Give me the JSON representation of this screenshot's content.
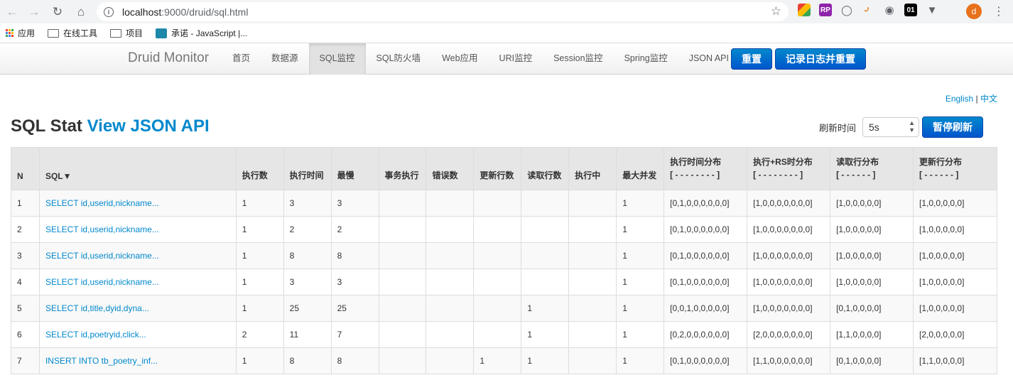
{
  "browser": {
    "url_host": "localhost",
    "url_rest": ":9000/druid/sql.html",
    "profile_initial": "d",
    "bookmarks": [
      {
        "label": "应用"
      },
      {
        "label": "在线工具"
      },
      {
        "label": "项目"
      },
      {
        "label": "承诺 - JavaScript |..."
      }
    ]
  },
  "navbar": {
    "brand": "Druid Monitor",
    "items": [
      "首页",
      "数据源",
      "SQL监控",
      "SQL防火墙",
      "Web应用",
      "URI监控",
      "Session监控",
      "Spring监控",
      "JSON API"
    ],
    "active_index": 2,
    "reset_label": "重置",
    "log_reset_label": "记录日志并重置"
  },
  "lang": {
    "english": "English",
    "sep": "|",
    "chinese": "中文"
  },
  "page": {
    "title_prefix": "SQL Stat",
    "title_link": "View JSON API",
    "refresh_label": "刷新时间",
    "refresh_value": "5s",
    "pause_label": "暂停刷新"
  },
  "table": {
    "headers": {
      "n": "N",
      "sql": "SQL▼",
      "exec_count": "执行数",
      "exec_time": "执行时间",
      "slowest": "最慢",
      "tx": "事务执行",
      "errors": "错误数",
      "update_rows": "更新行数",
      "read_rows": "读取行数",
      "running": "执行中",
      "max_concurrency": "最大并发",
      "exec_time_dist": "执行时间分布",
      "exec_time_dist_sub": "[ - - - - - - - - ]",
      "exec_rs_dist": "执行+RS时分布",
      "exec_rs_dist_sub": "[ - - - - - - - - ]",
      "read_dist": "读取行分布",
      "read_dist_sub": "[ - - - - - - ]",
      "update_dist": "更新行分布",
      "update_dist_sub": "[ - - - - - - ]"
    },
    "rows": [
      {
        "n": "1",
        "sql": "SELECT id,userid,nickname...",
        "exec_count": "1",
        "exec_time": "3",
        "slowest": "3",
        "tx": "",
        "errors": "",
        "update_rows": "",
        "read_rows": "",
        "running": "",
        "max_concurrency": "1",
        "exec_time_dist": "[0,1,0,0,0,0,0,0]",
        "exec_rs_dist": "[1,0,0,0,0,0,0,0]",
        "read_dist": "[1,0,0,0,0,0]",
        "update_dist": "[1,0,0,0,0,0]"
      },
      {
        "n": "2",
        "sql": "SELECT id,userid,nickname...",
        "exec_count": "1",
        "exec_time": "2",
        "slowest": "2",
        "tx": "",
        "errors": "",
        "update_rows": "",
        "read_rows": "",
        "running": "",
        "max_concurrency": "1",
        "exec_time_dist": "[0,1,0,0,0,0,0,0]",
        "exec_rs_dist": "[1,0,0,0,0,0,0,0]",
        "read_dist": "[1,0,0,0,0,0]",
        "update_dist": "[1,0,0,0,0,0]"
      },
      {
        "n": "3",
        "sql": "SELECT id,userid,nickname...",
        "exec_count": "1",
        "exec_time": "8",
        "slowest": "8",
        "tx": "",
        "errors": "",
        "update_rows": "",
        "read_rows": "",
        "running": "",
        "max_concurrency": "1",
        "exec_time_dist": "[0,1,0,0,0,0,0,0]",
        "exec_rs_dist": "[1,0,0,0,0,0,0,0]",
        "read_dist": "[1,0,0,0,0,0]",
        "update_dist": "[1,0,0,0,0,0]"
      },
      {
        "n": "4",
        "sql": "SELECT id,userid,nickname...",
        "exec_count": "1",
        "exec_time": "3",
        "slowest": "3",
        "tx": "",
        "errors": "",
        "update_rows": "",
        "read_rows": "",
        "running": "",
        "max_concurrency": "1",
        "exec_time_dist": "[0,1,0,0,0,0,0,0]",
        "exec_rs_dist": "[1,0,0,0,0,0,0,0]",
        "read_dist": "[1,0,0,0,0,0]",
        "update_dist": "[1,0,0,0,0,0]"
      },
      {
        "n": "5",
        "sql": "SELECT id,title,dyid,dyna...",
        "exec_count": "1",
        "exec_time": "25",
        "slowest": "25",
        "tx": "",
        "errors": "",
        "update_rows": "",
        "read_rows": "1",
        "running": "",
        "max_concurrency": "1",
        "exec_time_dist": "[0,0,1,0,0,0,0,0]",
        "exec_rs_dist": "[1,0,0,0,0,0,0,0]",
        "read_dist": "[0,1,0,0,0,0]",
        "update_dist": "[1,0,0,0,0,0]"
      },
      {
        "n": "6",
        "sql": "SELECT id,poetryid,click...",
        "exec_count": "2",
        "exec_time": "11",
        "slowest": "7",
        "tx": "",
        "errors": "",
        "update_rows": "",
        "read_rows": "1",
        "running": "",
        "max_concurrency": "1",
        "exec_time_dist": "[0,2,0,0,0,0,0,0]",
        "exec_rs_dist": "[2,0,0,0,0,0,0,0]",
        "read_dist": "[1,1,0,0,0,0]",
        "update_dist": "[2,0,0,0,0,0]"
      },
      {
        "n": "7",
        "sql": "INSERT INTO tb_poetry_inf...",
        "exec_count": "1",
        "exec_time": "8",
        "slowest": "8",
        "tx": "",
        "errors": "",
        "update_rows": "1",
        "read_rows": "1",
        "running": "",
        "max_concurrency": "1",
        "exec_time_dist": "[0,1,0,0,0,0,0,0]",
        "exec_rs_dist": "[1,1,0,0,0,0,0,0]",
        "read_dist": "[0,1,0,0,0,0]",
        "update_dist": "[1,1,0,0,0,0]"
      }
    ]
  }
}
